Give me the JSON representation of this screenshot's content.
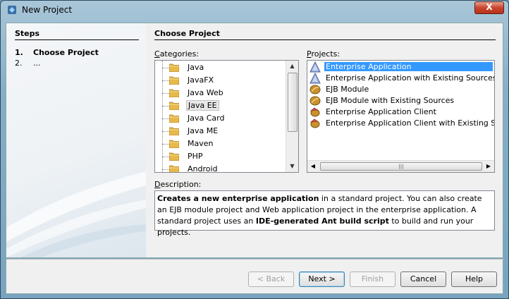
{
  "window": {
    "title": "New Project",
    "close_label": "X"
  },
  "steps": {
    "title": "Steps",
    "items": [
      {
        "num": "1.",
        "label": "Choose Project"
      },
      {
        "num": "2.",
        "label": "..."
      }
    ]
  },
  "main": {
    "title": "Choose Project",
    "categories_label": "Categories:",
    "projects_label": "Projects:",
    "description_label": "Description:"
  },
  "categories": [
    "Java",
    "JavaFX",
    "Java Web",
    "Java EE",
    "Java Card",
    "Java ME",
    "Maven",
    "PHP",
    "Android"
  ],
  "selected_category": "Java EE",
  "projects": [
    {
      "label": "Enterprise Application",
      "icon": "enterprise-app-icon"
    },
    {
      "label": "Enterprise Application with Existing Sources",
      "icon": "enterprise-app-icon"
    },
    {
      "label": "EJB Module",
      "icon": "ejb-bean-icon"
    },
    {
      "label": "EJB Module with Existing Sources",
      "icon": "ejb-bean-icon"
    },
    {
      "label": "Enterprise Application Client",
      "icon": "app-client-icon"
    },
    {
      "label": "Enterprise Application Client with Existing Sources",
      "icon": "app-client-icon"
    }
  ],
  "selected_project": "Enterprise Application",
  "description": {
    "part1_bold": "Creates a new enterprise application",
    "part2": " in a standard project. You can also create an EJB module project and Web application project in the enterprise application. A standard project uses an ",
    "part3_bold": "IDE-generated Ant build script",
    "part4": " to build and run your projects."
  },
  "buttons": {
    "back": "< Back",
    "next": "Next >",
    "finish": "Finish",
    "cancel": "Cancel",
    "help": "Help"
  },
  "colors": {
    "selection": "#3399ff",
    "folder": "#e8b84a"
  }
}
